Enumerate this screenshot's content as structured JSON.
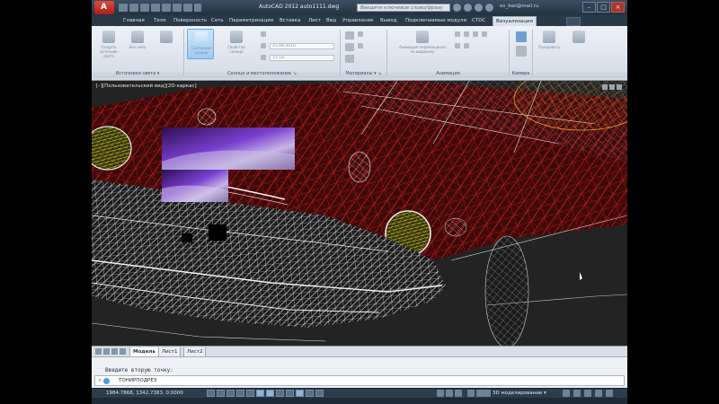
{
  "titlebar": {
    "logo_text": "A",
    "title": "AutoCAD 2012   auto1111.dwg",
    "search_placeholder": "Введите ключевое слово/фразу",
    "user": "ex_bwi@mail.ru",
    "minimize": "–",
    "maximize": "□",
    "close": "×"
  },
  "tabs": [
    {
      "label": "Главная"
    },
    {
      "label": "Тело"
    },
    {
      "label": "Поверхность"
    },
    {
      "label": "Сеть"
    },
    {
      "label": "Параметризация"
    },
    {
      "label": "Вставка"
    },
    {
      "label": "Лист"
    },
    {
      "label": "Вид"
    },
    {
      "label": "Управление"
    },
    {
      "label": "Вывод"
    },
    {
      "label": "Подключаемые модули"
    },
    {
      "label": "CTDC"
    },
    {
      "label": "Визуализация",
      "active": true
    }
  ],
  "ribbon": {
    "btn_create_light": "Создать источник света",
    "btn_no_sky": "Без неба",
    "btn_sun_status": "Состояние солнца",
    "btn_sun_properties": "Свойства солнца",
    "btn_render": "Тонировать",
    "date_value": "21.08.2010",
    "time_value": "15:18",
    "btn_materials": "Материалы",
    "btn_animation": "Анимация перемещения по видовому",
    "btn_camera": "Камера",
    "btn_render_settings": "Тонировать",
    "panels": {
      "lights": "Источники света ▾",
      "sun": "Солнце и местоположение ↘",
      "materials": "Материалы ▾ ↘",
      "animation": "Анимация",
      "camera": "Камера"
    }
  },
  "viewport": {
    "label": "[–][Пользовательский вид][2D-каркас]",
    "ctrl_min": "–",
    "ctrl_max": "□",
    "ctrl_close": "×"
  },
  "layout_tabs": [
    {
      "label": "Модель",
      "active": true
    },
    {
      "label": "Лист1"
    },
    {
      "label": "Лист2"
    }
  ],
  "command": {
    "history": "Введите вторую точку:",
    "input": "ТОНИРПОДРЕЗ",
    "close": "×"
  },
  "status": {
    "coords": "1984.7868, 1342.7383, 0.0000",
    "workspace": "3D моделирование ▾"
  },
  "colors": {
    "wire_red": "#c81a1a",
    "wire_white": "#e6e6e6",
    "wire_yellow": "#d9d11f",
    "wire_orange": "#d98b16",
    "render_purple": "#5a2a9a",
    "accent": "#3f7fc4"
  }
}
